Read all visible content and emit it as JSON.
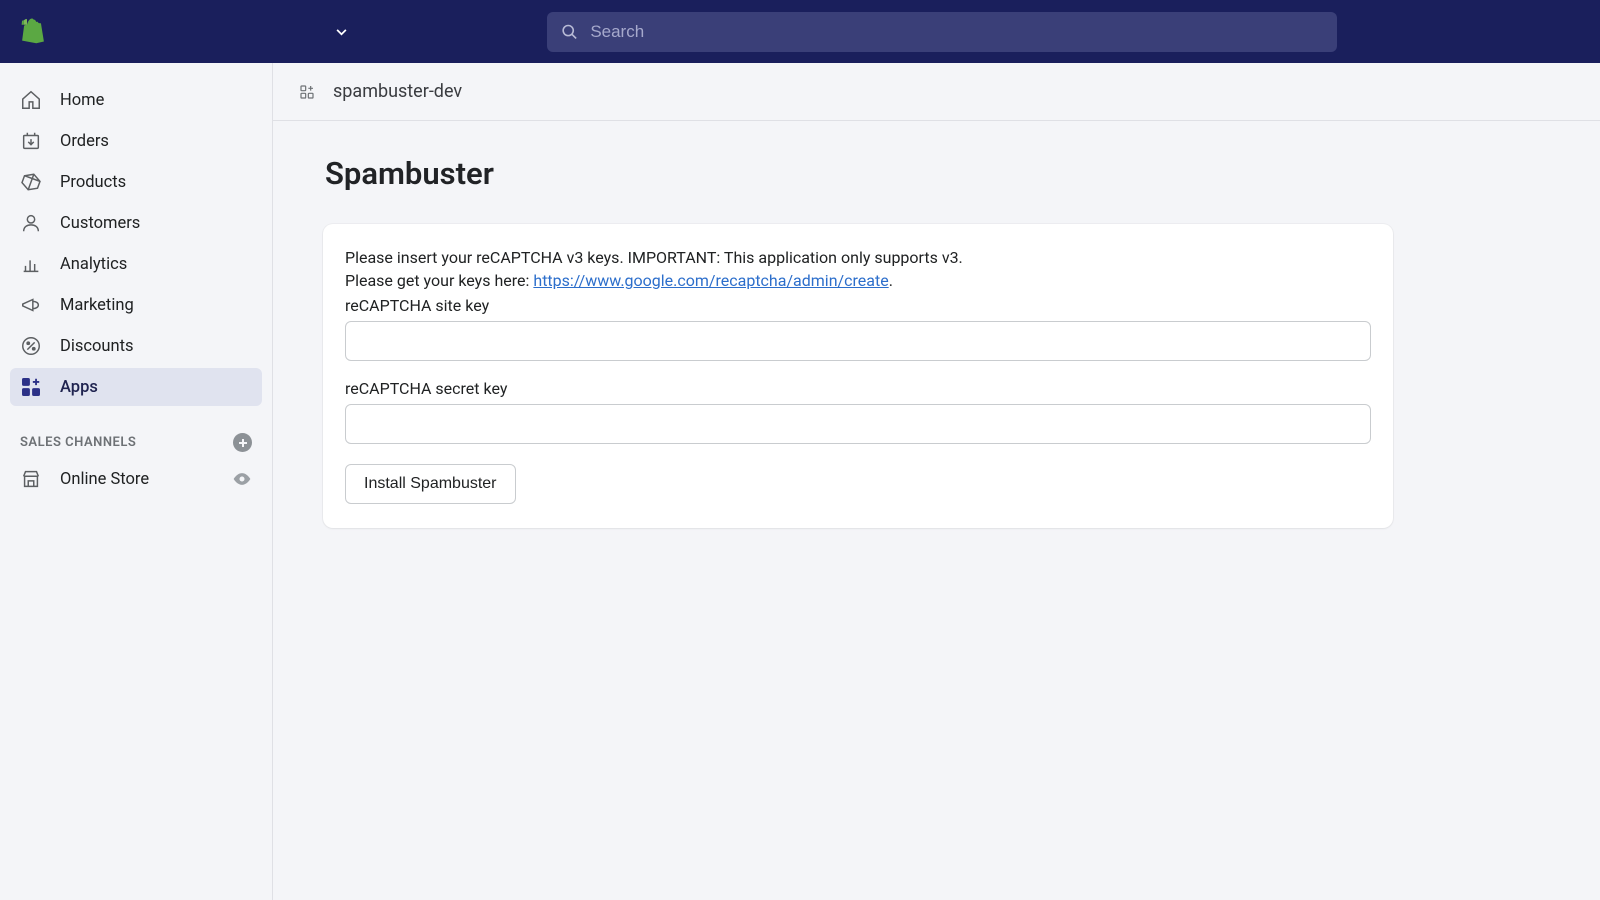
{
  "header": {
    "search_placeholder": "Search"
  },
  "sidebar": {
    "items": [
      {
        "label": "Home"
      },
      {
        "label": "Orders"
      },
      {
        "label": "Products"
      },
      {
        "label": "Customers"
      },
      {
        "label": "Analytics"
      },
      {
        "label": "Marketing"
      },
      {
        "label": "Discounts"
      },
      {
        "label": "Apps"
      }
    ],
    "sales_channels_title": "SALES CHANNELS",
    "channels": [
      {
        "label": "Online Store"
      }
    ]
  },
  "breadcrumb": {
    "app_name": "spambuster-dev"
  },
  "page": {
    "title": "Spambuster",
    "description_line1": "Please insert your reCAPTCHA v3 keys. IMPORTANT: This application only supports v3.",
    "description_line2_prefix": "Please get your keys here: ",
    "description_link_text": "https://www.google.com/recaptcha/admin/create",
    "description_line2_suffix": ".",
    "site_key_label": "reCAPTCHA site key",
    "site_key_value": "",
    "secret_key_label": "reCAPTCHA secret key",
    "secret_key_value": "",
    "install_button": "Install Spambuster"
  }
}
